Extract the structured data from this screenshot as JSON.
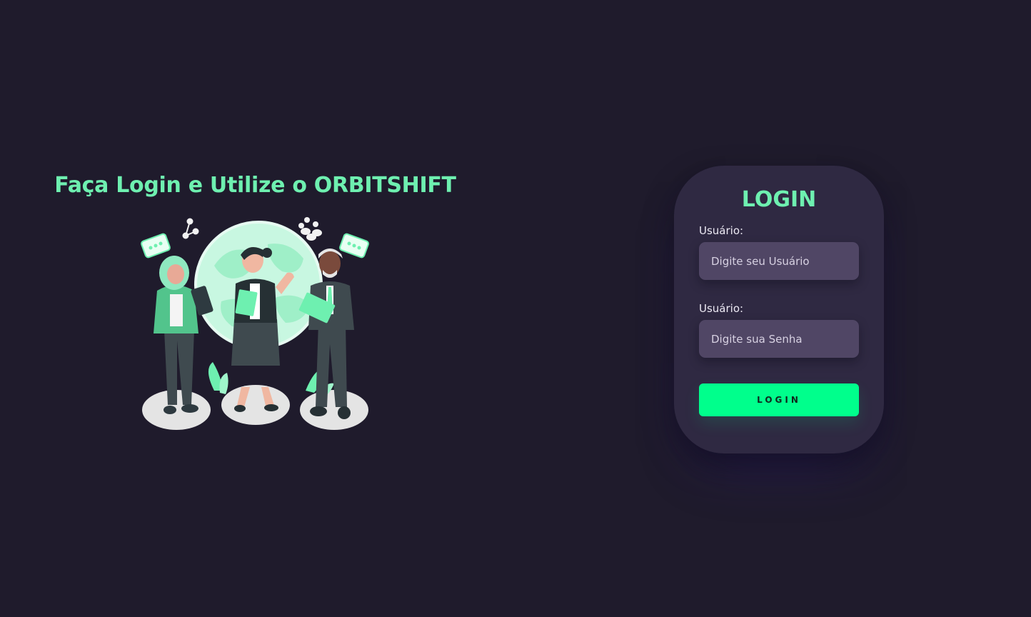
{
  "hero": {
    "title": "Faça Login e Utilize o ORBITSHIFT",
    "illustration": "team-of-professionals-around-globe"
  },
  "login": {
    "title": "LOGIN",
    "username_label": "Usuário:",
    "username_placeholder": "Digite seu Usuário",
    "password_label": "Usuário:",
    "password_placeholder": "Digite sua Senha",
    "button_label": "LOGIN"
  },
  "colors": {
    "background": "#1f1b2c",
    "card": "#2f2942",
    "accent_text": "#6ef0b0",
    "input": "#504665",
    "button": "#00ff8c"
  },
  "icons": [
    "chat-bubble-icon",
    "share-icon",
    "people-group-icon"
  ]
}
